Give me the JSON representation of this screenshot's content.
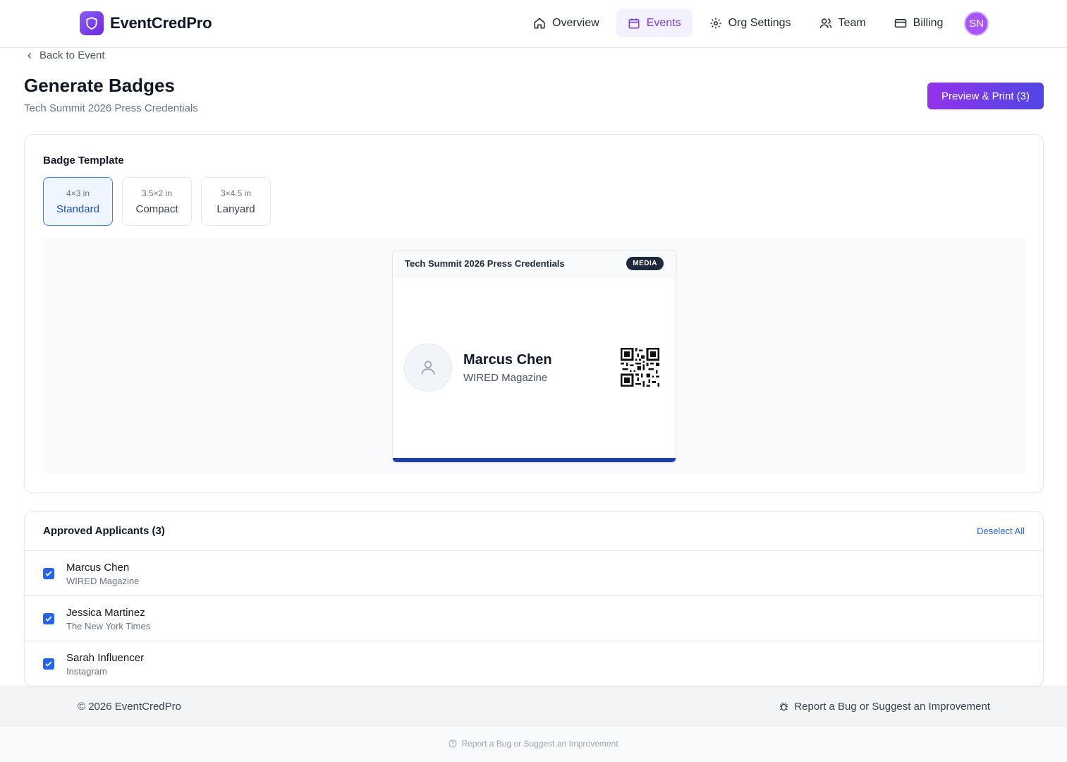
{
  "brand": {
    "name": "EventCredPro"
  },
  "nav": {
    "items": [
      {
        "label": "Overview",
        "icon": "home-icon"
      },
      {
        "label": "Events",
        "icon": "calendar-icon",
        "active": true
      },
      {
        "label": "Org Settings",
        "icon": "gear-icon"
      },
      {
        "label": "Team",
        "icon": "users-icon"
      },
      {
        "label": "Billing",
        "icon": "credit-card-icon"
      }
    ],
    "avatar_initials": "SN"
  },
  "header": {
    "back_label": "Back to Event",
    "title": "Generate Badges",
    "subtitle": "Tech Summit 2026 Press Credentials",
    "print_button": "Preview & Print (3)"
  },
  "template": {
    "label": "Badge Template",
    "options": [
      {
        "size": "4×3 in",
        "name": "Standard",
        "selected": true
      },
      {
        "size": "3.5×2 in",
        "name": "Compact"
      },
      {
        "size": "3×4.5 in",
        "name": "Lanyard"
      }
    ]
  },
  "badge_preview": {
    "event": "Tech Summit 2026 Press Credentials",
    "tag": "MEDIA",
    "name": "Marcus Chen",
    "org": "WIRED Magazine",
    "accent_color": "#1e40af"
  },
  "applicants": {
    "title": "Approved Applicants (3)",
    "deselect_label": "Deselect All",
    "rows": [
      {
        "name": "Marcus Chen",
        "org": "WIRED Magazine",
        "checked": true
      },
      {
        "name": "Jessica Martinez",
        "org": "The New York Times",
        "checked": true
      },
      {
        "name": "Sarah Influencer",
        "org": "Instagram",
        "checked": true
      }
    ]
  },
  "footer": {
    "copyright": "© 2026 EventCredPro",
    "bug_link": "Report a Bug or Suggest an Improvement",
    "sub_link": "Report a Bug or Suggest an Improvement"
  },
  "colors": {
    "brand": "#7c3aed",
    "accent": "#2563eb",
    "print_gradient": [
      "#9333ea",
      "#4f46e5"
    ]
  }
}
